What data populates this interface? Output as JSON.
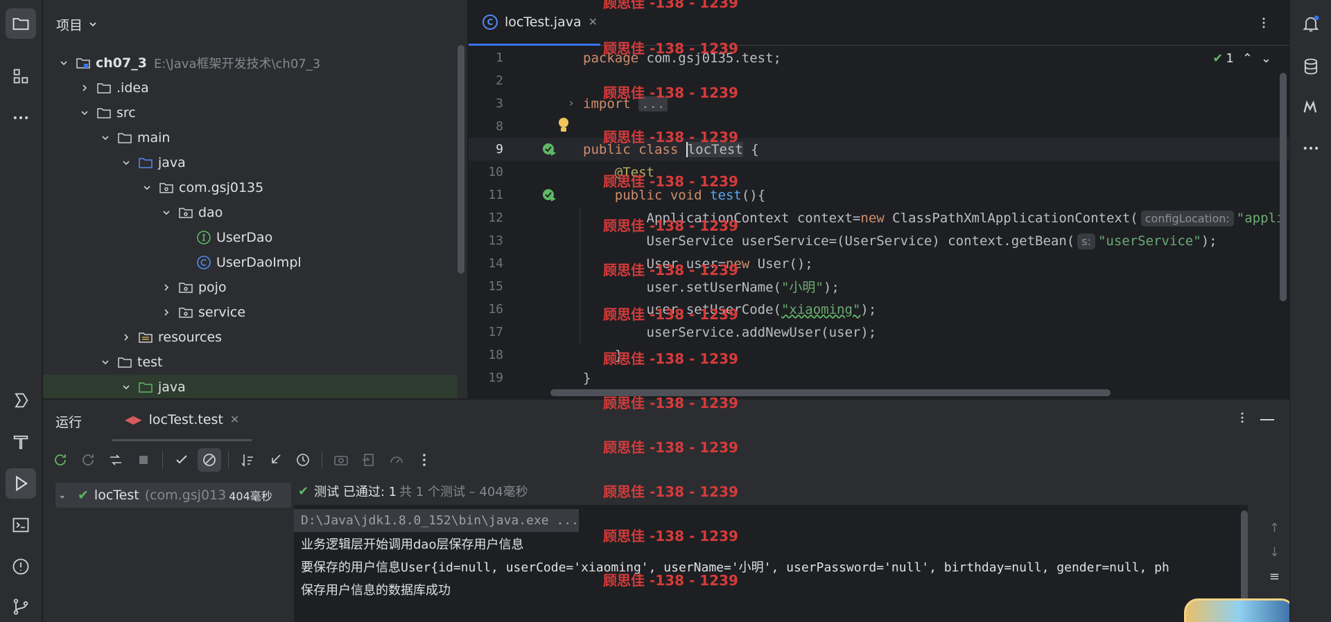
{
  "project": {
    "title": "项目",
    "tree": [
      {
        "label": "ch07_3",
        "path": "E:\\Java框架开发技术\\ch07_3"
      },
      {
        "label": ".idea"
      },
      {
        "label": "src"
      },
      {
        "label": "main"
      },
      {
        "label": "java"
      },
      {
        "label": "com.gsj0135"
      },
      {
        "label": "dao"
      },
      {
        "label": "UserDao"
      },
      {
        "label": "UserDaoImpl"
      },
      {
        "label": "pojo"
      },
      {
        "label": "service"
      },
      {
        "label": "resources"
      },
      {
        "label": "test"
      },
      {
        "label": "java"
      }
    ]
  },
  "editor": {
    "tab_label": "locTest.java",
    "inspection_count": "1",
    "line_numbers": [
      "1",
      "2",
      "3",
      "8",
      "9",
      "10",
      "11",
      "12",
      "13",
      "14",
      "15",
      "16",
      "17",
      "18",
      "19"
    ],
    "lines": {
      "l1_kw": "package",
      "l1_rest": " com.gsj0135.test;",
      "l3_kw": "import",
      "l3_fold": "...",
      "l9_kw": "public class",
      "l9_name": "locTest",
      "l9_rest": " {",
      "l10": "@Test",
      "l11_kw": "public void",
      "l11_fn": "test",
      "l11_rest": "(){",
      "l12_a": "ApplicationContext context=",
      "l12_kw": "new",
      "l12_b": " ClassPathXmlApplicationContext(",
      "l12_hint": "configLocation:",
      "l12_str": "\"appli",
      "l13_a": "UserService userService=(UserService) context.getBean(",
      "l13_hint": "s:",
      "l13_str": "\"userService\"",
      "l13_b": ");",
      "l14_a": "User user=",
      "l14_kw": "new",
      "l14_b": " User();",
      "l15_a": "user.setUserName(",
      "l15_str": "\"小明\"",
      "l15_b": ");",
      "l16_a": "user.setUserCode(",
      "l16_str": "\"xiaoming\"",
      "l16_b": ");",
      "l17": "userService.addNewUser(user);",
      "l18": "}",
      "l19": "}"
    }
  },
  "run": {
    "title": "运行",
    "tab_label": "locTest.test",
    "test_tree": {
      "name": "locTest",
      "package": "(com.gsj013",
      "time": "404毫秒"
    },
    "status": {
      "label": "测试 已通过: 1",
      "detail": "共 1 个测试 – 404毫秒"
    },
    "console": [
      "D:\\Java\\jdk1.8.0_152\\bin\\java.exe ...",
      "业务逻辑层开始调用dao层保存用户信息",
      "要保存的用户信息User{id=null, userCode='xiaoming', userName='小明', userPassword='null', birthday=null, gender=null, ph",
      "保存用户信息的数据库成功"
    ]
  },
  "watermark": "顾思佳 -138 - 1239",
  "colors": {
    "accent": "#3574f0",
    "success": "#5fb865",
    "watermark": "#d63b3b"
  }
}
